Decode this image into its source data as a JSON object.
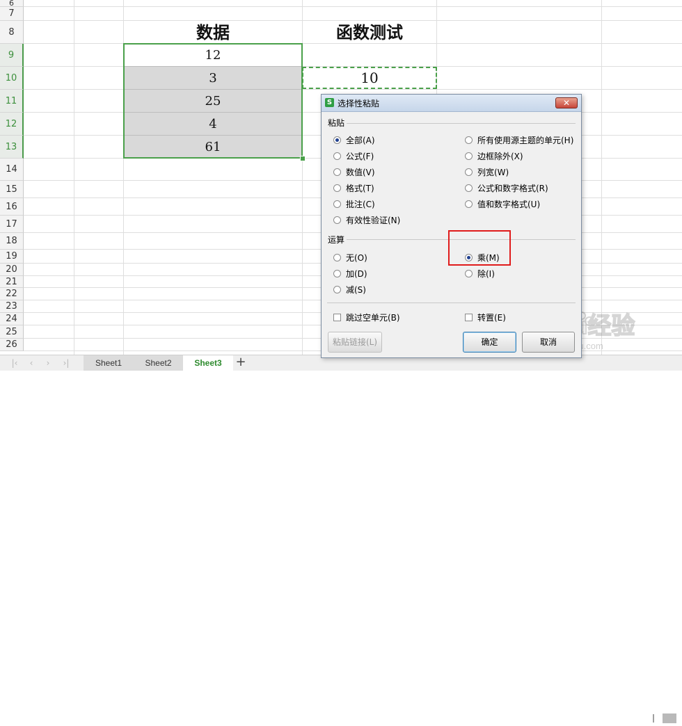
{
  "spreadsheet": {
    "row_numbers": [
      "6",
      "7",
      "8",
      "9",
      "10",
      "11",
      "12",
      "13",
      "14",
      "15",
      "16",
      "17",
      "18",
      "19",
      "20",
      "21",
      "22",
      "23",
      "24",
      "25",
      "26"
    ],
    "header_data": "数据",
    "header_func": "函数测试",
    "data_values": [
      "12",
      "3",
      "25",
      "4",
      "61"
    ],
    "copied_value": "10"
  },
  "tabs": {
    "items": [
      "Sheet1",
      "Sheet2",
      "Sheet3"
    ],
    "active": "Sheet3",
    "add_label": "+"
  },
  "dialog": {
    "title": "选择性粘贴",
    "close_label": "✕",
    "paste_section": "粘贴",
    "paste_options": [
      "全部(A)",
      "公式(F)",
      "数值(V)",
      "格式(T)",
      "批注(C)",
      "有效性验证(N)"
    ],
    "paste_options_right": [
      "所有使用源主题的单元(H)",
      "边框除外(X)",
      "列宽(W)",
      "公式和数字格式(R)",
      "值和数字格式(U)"
    ],
    "operation_section": "运算",
    "operation_options": [
      "无(O)",
      "加(D)",
      "减(S)"
    ],
    "operation_options_right": [
      "乘(M)",
      "除(I)"
    ],
    "skip_blanks": "跳过空单元(B)",
    "transpose": "转置(E)",
    "paste_link_button": "粘贴链接(L)",
    "ok_button": "确定",
    "cancel_button": "取消"
  },
  "watermark": {
    "brand": "Baidu经验",
    "url": "jingyan.baidu.com"
  },
  "colors": {
    "selection_green": "#4aa04a",
    "highlight_red": "#e01b1b",
    "active_tab": "#2d8a2d"
  }
}
